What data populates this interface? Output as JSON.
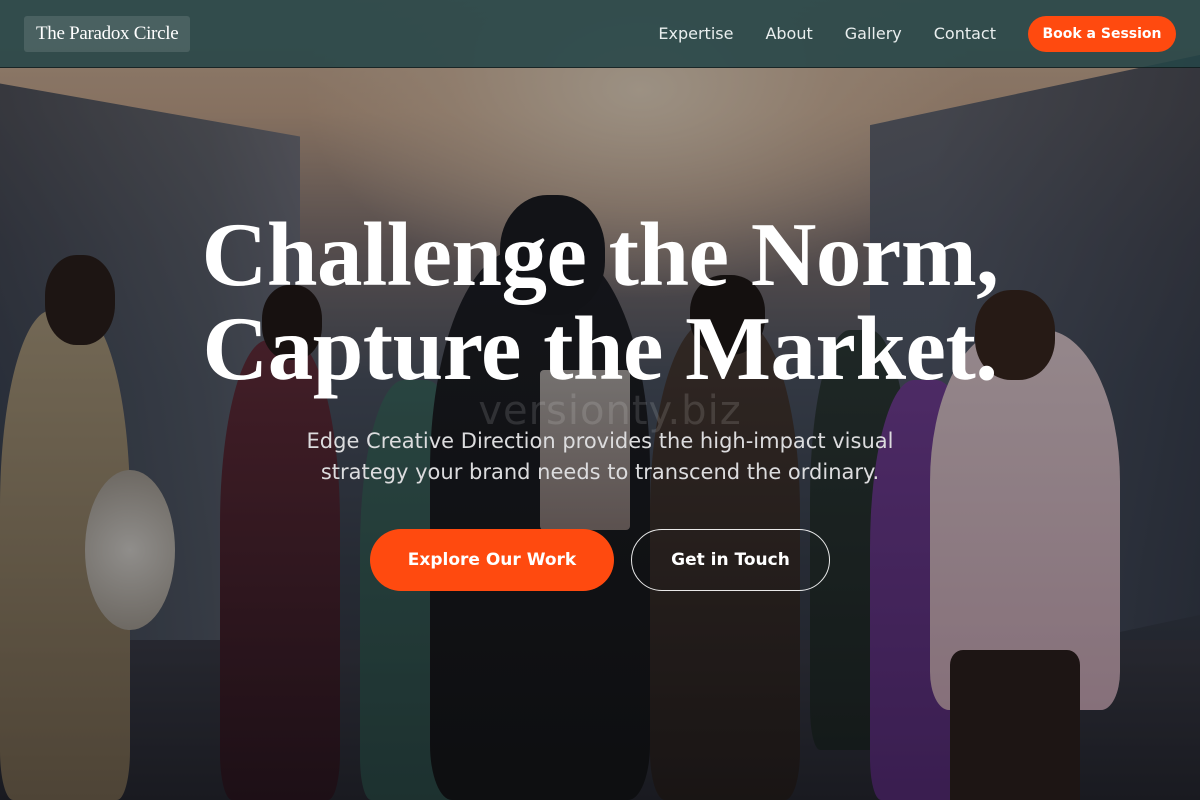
{
  "navbar": {
    "brand": "The Paradox Circle",
    "links": [
      "Expertise",
      "About",
      "Gallery",
      "Contact"
    ],
    "cta_label": "Book a Session"
  },
  "hero": {
    "headline_line1": "Challenge the Norm,",
    "headline_line2": "Capture the Market.",
    "watermark": "versionty.biz",
    "subtitle_line1": "Edge Creative Direction provides the high-impact visual",
    "subtitle_line2": "strategy your brand needs to transcend the ordinary.",
    "primary_button": "Explore Our Work",
    "secondary_button": "Get in Touch",
    "image_alt": "group-of-models-in-gallery-photo"
  },
  "colors": {
    "accent": "#ff4a0f",
    "navbar_bg": "#264648",
    "text": "#ffffff"
  }
}
